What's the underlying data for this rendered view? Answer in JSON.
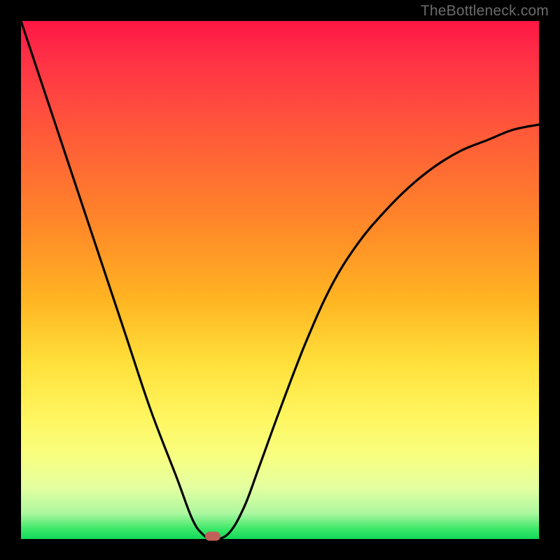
{
  "watermark": "TheBottleneck.com",
  "chart_data": {
    "type": "line",
    "title": "",
    "xlabel": "",
    "ylabel": "",
    "xlim": [
      0,
      100
    ],
    "ylim": [
      0,
      100
    ],
    "series": [
      {
        "name": "curve",
        "x": [
          0,
          5,
          10,
          15,
          20,
          25,
          30,
          33,
          35,
          37,
          40,
          43,
          46,
          50,
          55,
          60,
          65,
          70,
          75,
          80,
          85,
          90,
          95,
          100
        ],
        "y": [
          100,
          85,
          70,
          55,
          40,
          25,
          12,
          4,
          1,
          0,
          1,
          6,
          14,
          25,
          38,
          49,
          57,
          63,
          68,
          72,
          75,
          77,
          79,
          80
        ]
      }
    ],
    "marker": {
      "x": 37,
      "y": 0
    },
    "gradient_stops": [
      {
        "pos": 0.0,
        "color": "#ff1744"
      },
      {
        "pos": 0.4,
        "color": "#ff8a28"
      },
      {
        "pos": 0.7,
        "color": "#fff04a"
      },
      {
        "pos": 0.9,
        "color": "#d8ff90"
      },
      {
        "pos": 1.0,
        "color": "#11d95a"
      }
    ]
  }
}
